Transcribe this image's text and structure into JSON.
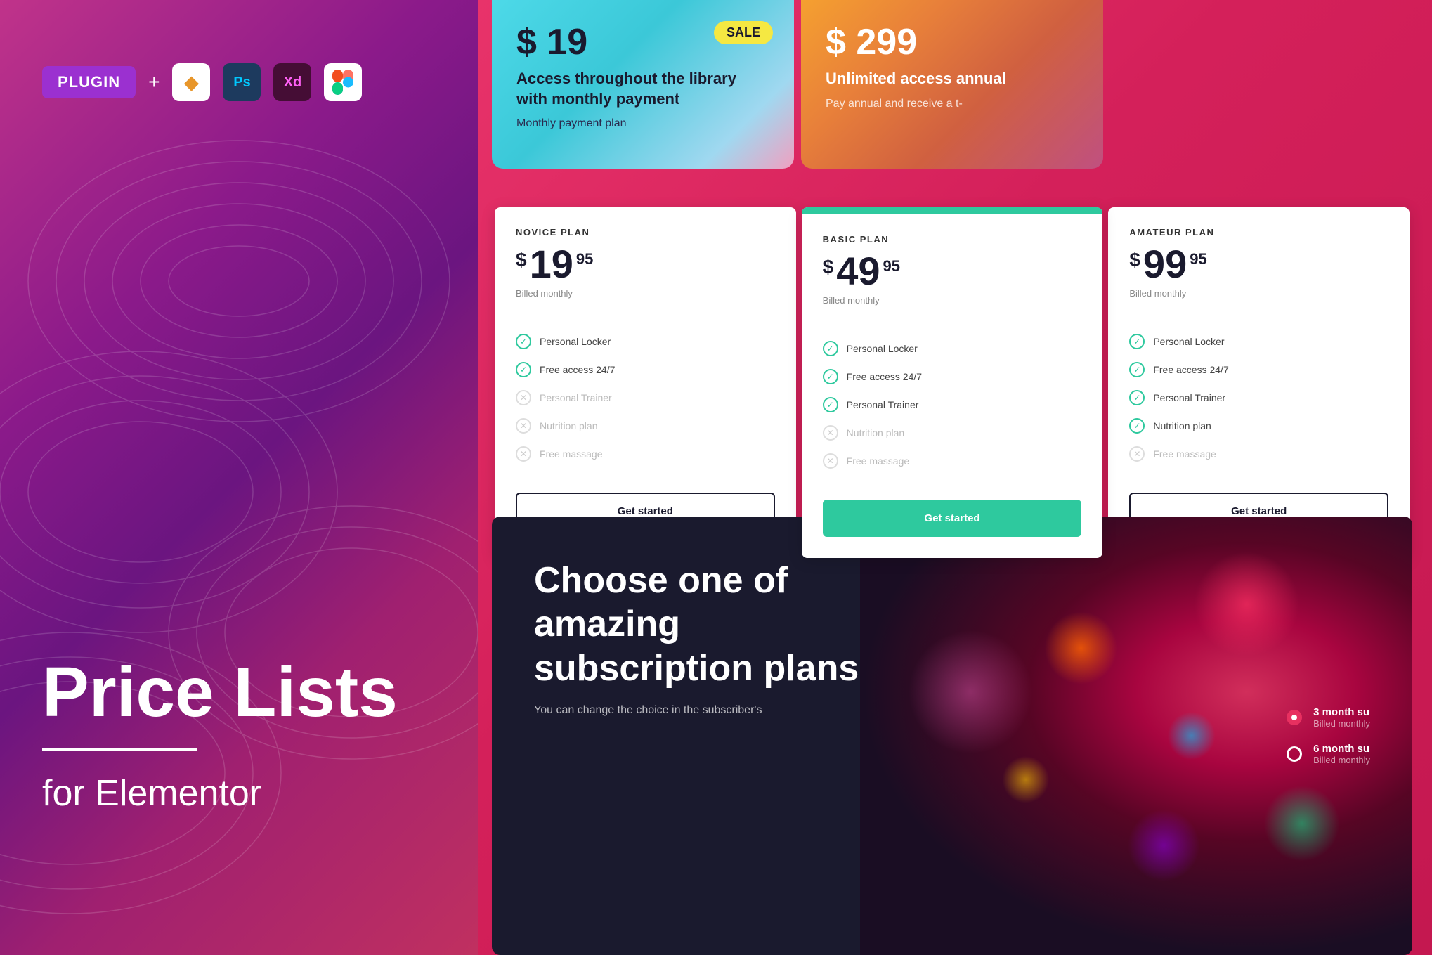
{
  "left": {
    "plugin_label": "PLUGIN",
    "plus": "+",
    "tools": [
      {
        "name": "Sketch",
        "abbr": "◆",
        "bg": "white",
        "color": "#f7a11a"
      },
      {
        "name": "Photoshop",
        "abbr": "Ps",
        "bg": "#1d3a5e",
        "color": "#00c8ff"
      },
      {
        "name": "XD",
        "abbr": "Xd",
        "bg": "#450d35",
        "color": "#ff61f6"
      },
      {
        "name": "Figma",
        "abbr": "❋",
        "bg": "white",
        "color": "#e83060"
      }
    ],
    "title": "Price Lists",
    "for_text": "for Elementor"
  },
  "right": {
    "top_cards": [
      {
        "price_main": "$ 19",
        "sale_badge": "SALE",
        "description": "Access throughout the library with monthly payment",
        "subtitle": "Monthly payment plan"
      },
      {
        "price_main": "$ 299",
        "description": "Unlimited access annual",
        "subtitle": "Pay annual and receive a t-"
      }
    ],
    "pricing_table": {
      "plans": [
        {
          "name": "NOVICE PLAN",
          "price_symbol": "$",
          "price_main": "19",
          "price_cents": "95",
          "billed": "Billed monthly",
          "featured": false,
          "features": [
            {
              "label": "Personal Locker",
              "enabled": true
            },
            {
              "label": "Free access 24/7",
              "enabled": true
            },
            {
              "label": "Personal Trainer",
              "enabled": false
            },
            {
              "label": "Nutrition plan",
              "enabled": false
            },
            {
              "label": "Free massage",
              "enabled": false
            }
          ],
          "button_label": "Get started"
        },
        {
          "name": "BASIC PLAN",
          "price_symbol": "$",
          "price_main": "49",
          "price_cents": "95",
          "billed": "Billed monthly",
          "featured": true,
          "features": [
            {
              "label": "Personal Locker",
              "enabled": true
            },
            {
              "label": "Free access 24/7",
              "enabled": true
            },
            {
              "label": "Personal Trainer",
              "enabled": true
            },
            {
              "label": "Nutrition plan",
              "enabled": false
            },
            {
              "label": "Free massage",
              "enabled": false
            }
          ],
          "button_label": "Get started"
        },
        {
          "name": "AMATEUR PLAN",
          "price_symbol": "$",
          "price_main": "99",
          "price_cents": "95",
          "billed": "Billed monthly",
          "featured": false,
          "features": [
            {
              "label": "Personal Locker",
              "enabled": true
            },
            {
              "label": "Free access 24/7",
              "enabled": true
            },
            {
              "label": "Personal Trainer",
              "enabled": true
            },
            {
              "label": "Nutrition plan",
              "enabled": true
            },
            {
              "label": "Free massage",
              "enabled": false
            }
          ],
          "button_label": "Get started"
        }
      ]
    },
    "bottom_section": {
      "title": "Choose one of amazing subscription plans",
      "subtitle": "You can change the choice in the subscriber's",
      "options": [
        {
          "label": "3 month su",
          "sublabel": "Billed monthly",
          "selected": true
        },
        {
          "label": "6 month su",
          "sublabel": "Billed monthly",
          "selected": false
        }
      ]
    }
  }
}
